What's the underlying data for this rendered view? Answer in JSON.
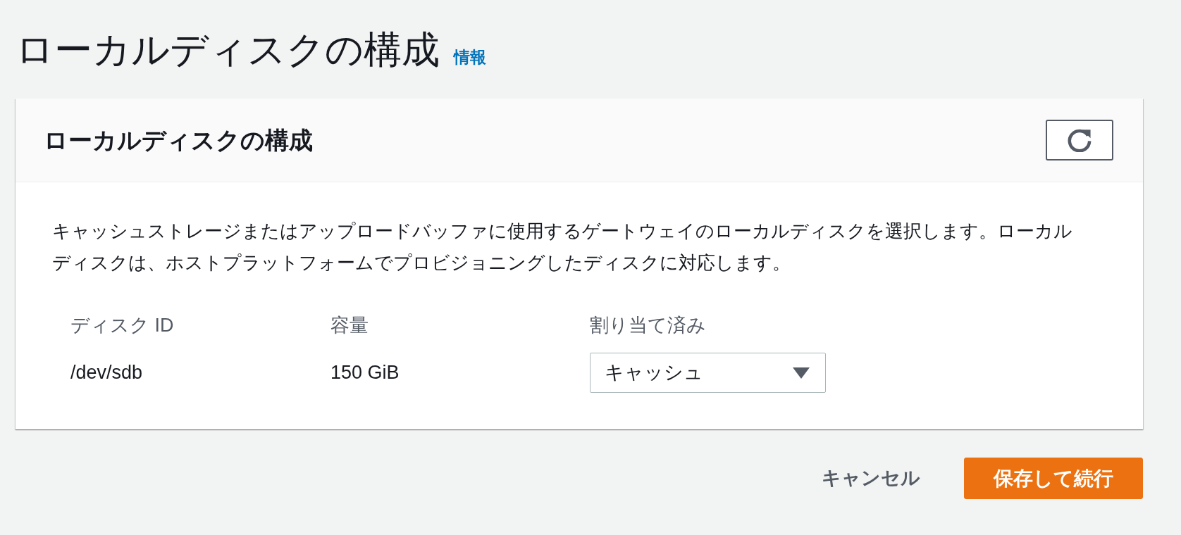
{
  "page": {
    "title": "ローカルディスクの構成",
    "info_link": "情報"
  },
  "panel": {
    "title": "ローカルディスクの構成",
    "description": "キャッシュストレージまたはアップロードバッファに使用するゲートウェイのローカルディスクを選択します。ローカルディスクは、ホストプラットフォームでプロビジョニングしたディスクに対応します。",
    "table": {
      "columns": [
        "ディスク ID",
        "容量",
        "割り当て済み"
      ],
      "rows": [
        {
          "disk_id": "/dev/sdb",
          "capacity": "150 GiB",
          "allocated": "キャッシュ"
        }
      ]
    }
  },
  "buttons": [
    {
      "label": "キャンセル",
      "kind": "link"
    },
    {
      "label": "保存して続行",
      "kind": "primary"
    }
  ]
}
